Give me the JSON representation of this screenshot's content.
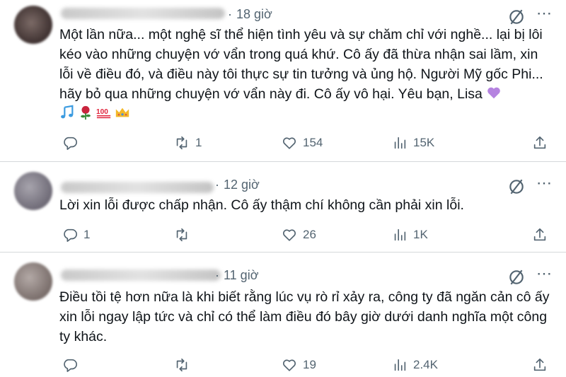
{
  "posts": [
    {
      "time": "18 giờ",
      "text": "Một lần nữa... một nghệ sĩ thể hiện tình yêu và sự chăm chỉ với nghề... lại bị lôi kéo vào những chuyện vớ vẩn trong quá khứ. Cô ấy đã thừa nhận sai lầm, xin lỗi về điều đó, và điều này tôi thực sự tin tưởng và ủng hộ. Người Mỹ gốc Phi... hãy bỏ qua những chuyện vớ vẩn này đi. Cô ấy vô hại. Yêu bạn, Lisa",
      "emojis": [
        "purple-heart",
        "musical-notes",
        "rose",
        "hundred-points",
        "crown"
      ],
      "replies": "",
      "reposts": "1",
      "likes": "154",
      "views": "15K"
    },
    {
      "time": "12 giờ",
      "text": "Lời xin lỗi được chấp nhận. Cô ấy thậm chí không cần phải xin lỗi.",
      "replies": "1",
      "reposts": "",
      "likes": "26",
      "views": "1K"
    },
    {
      "time": "11 giờ",
      "text": "Điều tồi tệ hơn nữa là khi biết rằng lúc vụ rò rỉ xảy ra, công ty đã ngăn cản cô ấy xin lỗi ngay lập tức và chỉ có thể làm điều đó bây giờ dưới danh nghĩa một công ty khác.",
      "replies": "",
      "reposts": "",
      "likes": "19",
      "views": "2.4K"
    }
  ],
  "icons": {
    "reply": "reply-icon",
    "repost": "repost-icon",
    "like": "heart-icon",
    "views": "views-icon",
    "share": "share-icon",
    "grok": "grok-icon",
    "more": "more-icon"
  },
  "colors": {
    "text": "#0f1419",
    "muted": "#536471",
    "divider": "#d4d8db"
  }
}
